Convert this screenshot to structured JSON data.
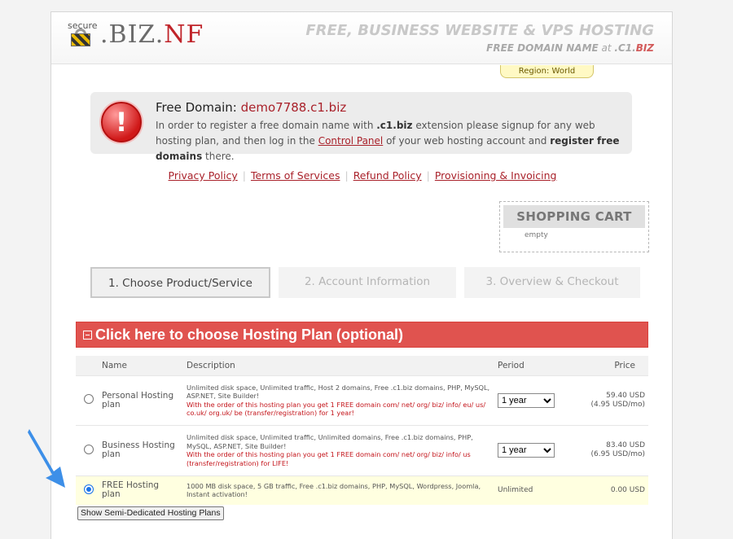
{
  "header": {
    "logo_secure": "secure",
    "logo_biz": ".BIZ.",
    "logo_nf": "NF",
    "tagline_main": "FREE, BUSINESS WEBSITE & VPS HOSTING",
    "tagline_sub_1": "FREE DOMAIN NAME",
    "tagline_sub_at": " at ",
    "tagline_sub_c1": ".C1.",
    "tagline_sub_biz": "BIZ",
    "region": "Region: World"
  },
  "notice": {
    "title_prefix": "Free Domain: ",
    "domain": "demo7788.c1.biz",
    "body_1": "In order to register a free domain name with ",
    "body_ext": ".c1.biz",
    "body_2": " extension please signup for any web hosting plan, and then log in the ",
    "body_link": "Control Panel",
    "body_3": " of your web hosting account and ",
    "body_bold": "register free domains",
    "body_4": " there."
  },
  "links": [
    "Privacy Policy",
    "Terms of Services",
    "Refund Policy",
    "Provisioning & Invoicing"
  ],
  "cart": {
    "title": "SHOPPING CART",
    "status": "empty"
  },
  "steps": [
    {
      "label": "1. Choose Product/Service"
    },
    {
      "label": "2. Account Information"
    },
    {
      "label": "3. Overview & Checkout"
    }
  ],
  "plan_section": {
    "title": "Click here to choose Hosting Plan (optional)"
  },
  "table": {
    "headers": {
      "name": "Name",
      "description": "Description",
      "period": "Period",
      "price": "Price"
    },
    "rows": [
      {
        "name": "Personal Hosting plan",
        "desc": "Unlimited disk space, Unlimited traffic, Host 2 domains, Free .c1.biz domains, PHP, MySQL, ASP.NET, Site Builder!",
        "promo": "With the order of this hosting plan you get 1 FREE domain com/ net/ org/ biz/ info/ eu/ us/ co.uk/ org.uk/ be (transfer/registration) for 1 year!",
        "period": "1 year",
        "price": "59.40 USD",
        "price_monthly": "(4.95 USD/mo)"
      },
      {
        "name": "Business Hosting plan",
        "desc": "Unlimited disk space, Unlimited traffic, Unlimited domains, Free .c1.biz domains, PHP, MySQL, ASP.NET, Site Builder!",
        "promo": "With the order of this hosting plan you get 1 FREE domain com/ net/ org/ biz/ info/ us (transfer/registration) for LIFE!",
        "period": "1 year",
        "price": "83.40 USD",
        "price_monthly": "(6.95 USD/mo)"
      },
      {
        "name": "FREE Hosting plan",
        "desc": "1000 MB disk space, 5 GB traffic, Free .c1.biz domains, PHP, MySQL, Wordpress, Joomla, Instant activation!",
        "period": "Unlimited",
        "price": "0.00 USD"
      }
    ]
  },
  "semi_button": "Show Semi-Dedicated Hosting Plans",
  "colors": {
    "brand_red": "#c0242a",
    "section_red": "#e0534f",
    "link_red": "#a9212a",
    "selected_row": "#ffffe0",
    "arrow_blue": "#3d8fe8"
  }
}
